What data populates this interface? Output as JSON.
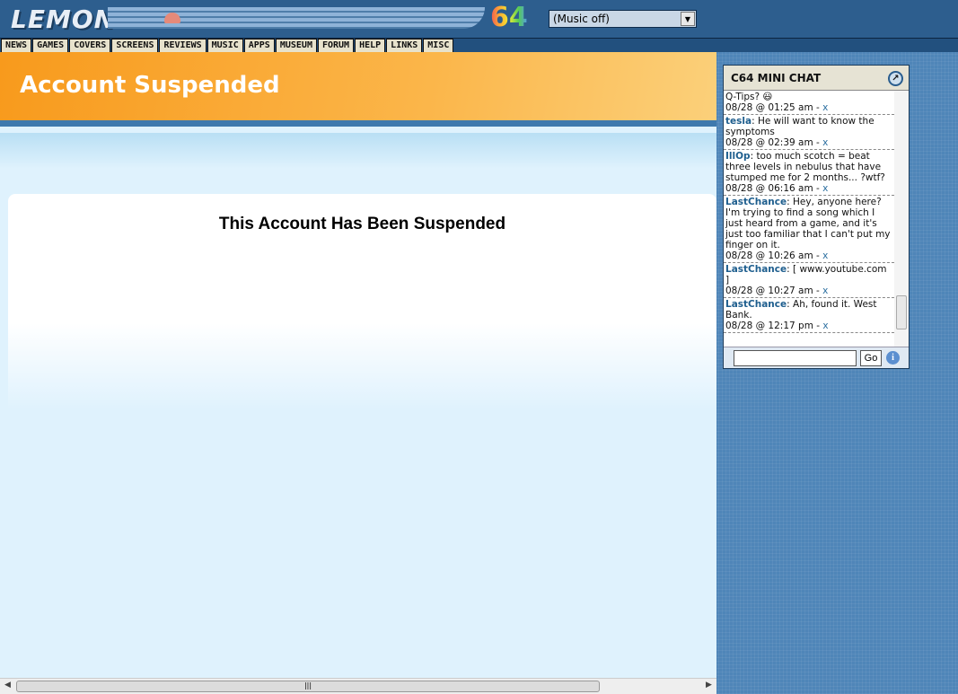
{
  "header": {
    "logo": "LEMON",
    "logo_suffix": "64",
    "music_select": "(Music off)"
  },
  "nav": [
    "NEWS",
    "GAMES",
    "COVERS",
    "SCREENS",
    "REVIEWS",
    "MUSIC",
    "APPS",
    "MUSEUM",
    "FORUM",
    "HELP",
    "LINKS",
    "MISC"
  ],
  "page": {
    "banner_title": "Account Suspended",
    "message": "This Account Has Been Suspended"
  },
  "chat": {
    "title": "C64 MINI CHAT",
    "go_label": "Go",
    "messages": [
      {
        "user": "",
        "text": "Q-Tips? 😃",
        "time": "08/28 @ 01:25 am - ",
        "x": "x"
      },
      {
        "user": "tesla",
        "text": ": He will want to know the symptoms",
        "time": "08/28 @ 02:39 am - ",
        "x": "x"
      },
      {
        "user": "IllOp",
        "text": ": too much scotch = beat three levels in nebulus that have stumped me for 2 months... ?wtf?",
        "time": "08/28 @ 06:16 am - ",
        "x": "x"
      },
      {
        "user": "LastChance",
        "text": ": Hey, anyone here? I'm trying to find a song which I just heard from a game, and it's just too familiar that I can't put my finger on it.",
        "time": "08/28 @ 10:26 am - ",
        "x": "x"
      },
      {
        "user": "LastChance",
        "text": ": [ www.youtube.com ]",
        "time": "08/28 @ 10:27 am - ",
        "x": "x"
      },
      {
        "user": "LastChance",
        "text": ": Ah, found it. West Bank.",
        "time": "08/28 @ 12:17 pm - ",
        "x": "x"
      }
    ]
  }
}
